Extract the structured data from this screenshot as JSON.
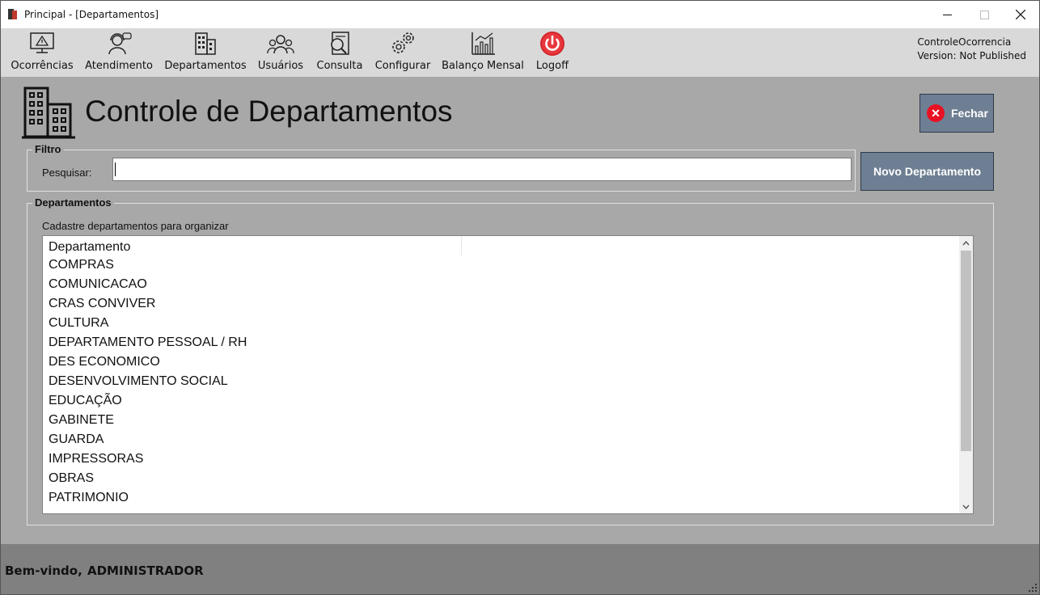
{
  "window": {
    "title": "Principal - [Departamentos]",
    "controls": {
      "minimize": "—",
      "maximize": "☐",
      "close": "✕"
    }
  },
  "toolbar": {
    "items": [
      {
        "label": "Ocorrências",
        "icon": "monitor-alert-icon"
      },
      {
        "label": "Atendimento",
        "icon": "support-agent-icon"
      },
      {
        "label": "Departamentos",
        "icon": "building-icon"
      },
      {
        "label": "Usuários",
        "icon": "users-group-icon"
      },
      {
        "label": "Consulta",
        "icon": "search-document-icon"
      },
      {
        "label": "Configurar",
        "icon": "gears-icon"
      },
      {
        "label": "Balanço Mensal",
        "icon": "bar-chart-icon"
      },
      {
        "label": "Logoff",
        "icon": "power-icon"
      }
    ],
    "app_name": "ControleOcorrencia",
    "version": "Version: Not Published"
  },
  "page": {
    "title": "Controle de Departamentos",
    "close_button": "Fechar"
  },
  "filter": {
    "legend": "Filtro",
    "search_label": "Pesquisar:",
    "search_value": "",
    "new_button": "Novo Departamento"
  },
  "departments": {
    "legend": "Departamentos",
    "hint": "Cadastre departamentos para organizar",
    "column_header": "Departamento",
    "rows": [
      "COMPRAS",
      "COMUNICACAO",
      "CRAS CONVIVER",
      "CULTURA",
      "DEPARTAMENTO PESSOAL / RH",
      "DES ECONOMICO",
      "DESENVOLVIMENTO SOCIAL",
      "EDUCAÇÃO",
      "GABINETE",
      "GUARDA",
      "IMPRESSORAS",
      "OBRAS",
      "PATRIMONIO"
    ]
  },
  "status": {
    "welcome": "Bem-vindo,",
    "user": "ADMINISTRADOR"
  },
  "colors": {
    "accent_button": "#6f7f93",
    "close_red": "#e81123",
    "background": "#a8a8a8"
  }
}
